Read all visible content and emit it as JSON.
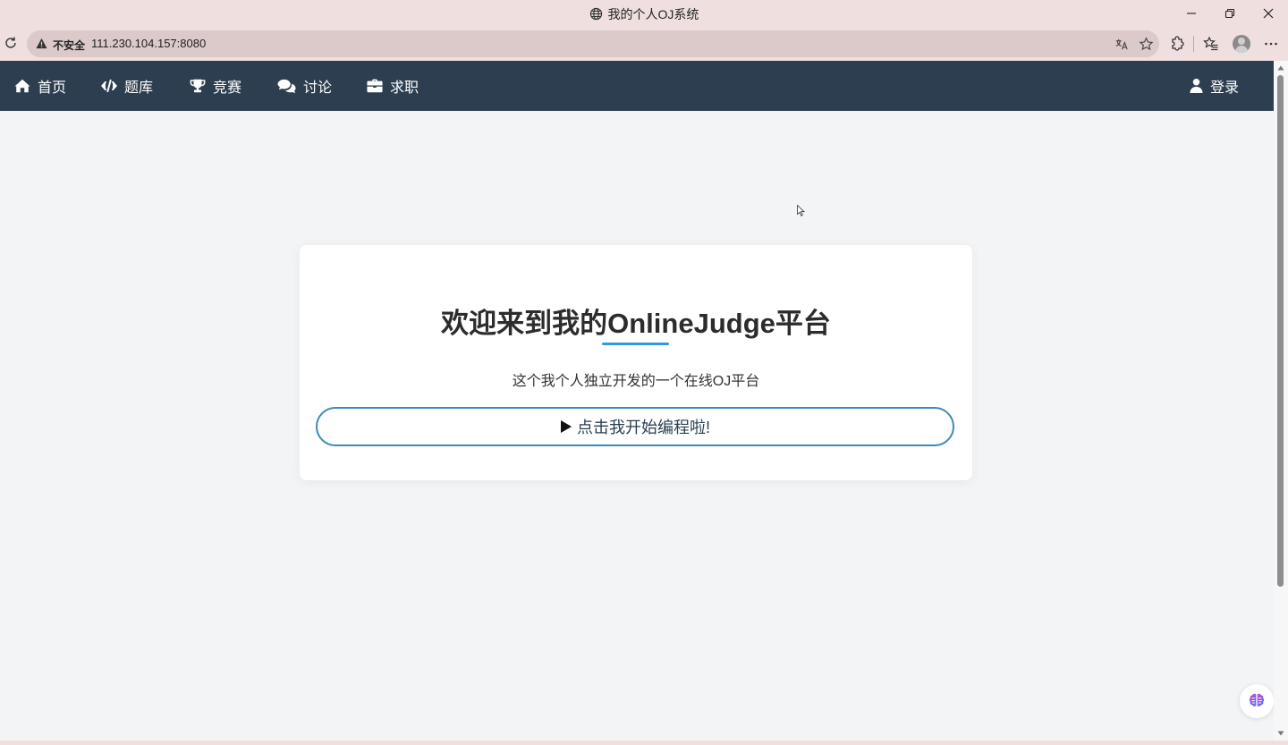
{
  "browser": {
    "tab_title": "我的个人OJ系统",
    "security_label": "不安全",
    "url": "111.230.104.157:8080"
  },
  "navbar": {
    "items": [
      {
        "label": "首页",
        "icon": "home-icon"
      },
      {
        "label": "题库",
        "icon": "code-icon"
      },
      {
        "label": "竞赛",
        "icon": "trophy-icon"
      },
      {
        "label": "讨论",
        "icon": "comments-icon"
      },
      {
        "label": "求职",
        "icon": "briefcase-icon"
      }
    ],
    "login_label": "登录",
    "background_color": "#2c3e50"
  },
  "hero": {
    "title": "欢迎来到我的OnlineJudge平台",
    "subtitle": "这个我个人独立开发的一个在线OJ平台",
    "start_button_label": "点击我开始编程啦!",
    "accent_color": "#3498db"
  }
}
